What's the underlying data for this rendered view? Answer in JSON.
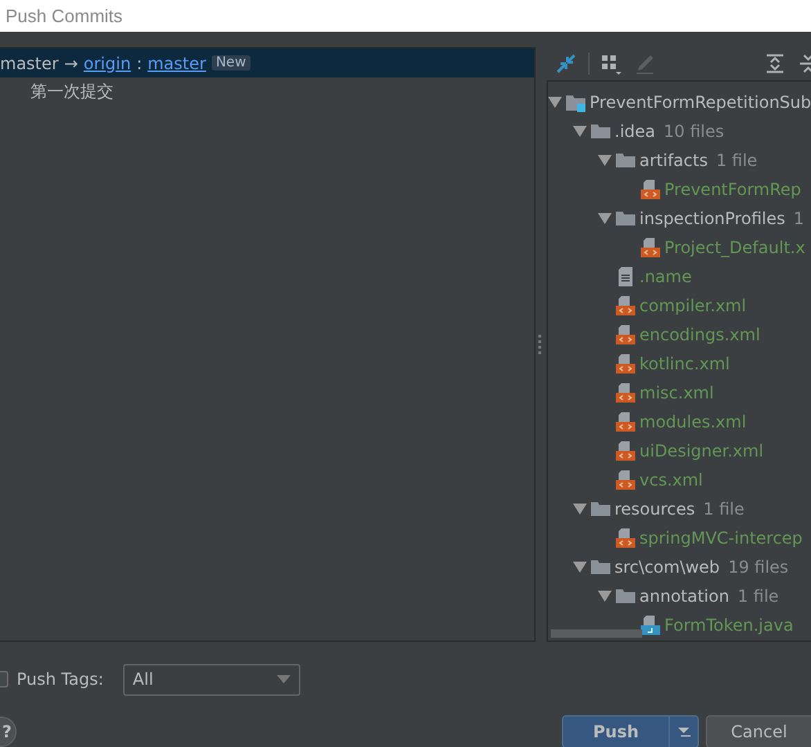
{
  "window": {
    "title": "Push Commits"
  },
  "push_target": {
    "branch": "master",
    "arrow": "→",
    "remote": "origin",
    "separator": ":",
    "remote_branch": "master",
    "badge": "New",
    "selected": true
  },
  "commits": [
    {
      "message": "第一次提交",
      "selected": false
    }
  ],
  "tree": [
    {
      "name": "PreventFormRepetitionSub",
      "kind": "module",
      "expanded": true,
      "children": [
        {
          "name": ".idea",
          "count": "10 files",
          "kind": "folder",
          "expanded": true,
          "children": [
            {
              "name": "artifacts",
              "count": "1 file",
              "kind": "folder",
              "expanded": true,
              "children": [
                {
                  "name": "PreventFormRep",
                  "kind": "xml"
                }
              ]
            },
            {
              "name": "inspectionProfiles",
              "count": "1",
              "kind": "folder",
              "expanded": true,
              "children": [
                {
                  "name": "Project_Default.x",
                  "kind": "xml"
                }
              ]
            },
            {
              "name": ".name",
              "kind": "text"
            },
            {
              "name": "compiler.xml",
              "kind": "xml"
            },
            {
              "name": "encodings.xml",
              "kind": "xml"
            },
            {
              "name": "kotlinc.xml",
              "kind": "xml"
            },
            {
              "name": "misc.xml",
              "kind": "xml"
            },
            {
              "name": "modules.xml",
              "kind": "xml"
            },
            {
              "name": "uiDesigner.xml",
              "kind": "xml"
            },
            {
              "name": "vcs.xml",
              "kind": "xml"
            }
          ]
        },
        {
          "name": "resources",
          "count": "1 file",
          "kind": "folder",
          "expanded": true,
          "children": [
            {
              "name": "springMVC-intercep",
              "kind": "xml"
            }
          ]
        },
        {
          "name": "src\\com\\web",
          "count": "19 files",
          "kind": "folder",
          "expanded": true,
          "children": [
            {
              "name": "annotation",
              "count": "1 file",
              "kind": "folder",
              "expanded": true,
              "children": [
                {
                  "name": "FormToken.java",
                  "kind": "java"
                }
              ]
            }
          ]
        }
      ]
    }
  ],
  "push_tags": {
    "label": "Push Tags:",
    "checked": false,
    "value": "All"
  },
  "buttons": [
    {
      "kind": "help",
      "label": "?"
    },
    {
      "kind": "primary",
      "label": "Push"
    },
    {
      "kind": "secondary",
      "label": "Cancel"
    }
  ]
}
